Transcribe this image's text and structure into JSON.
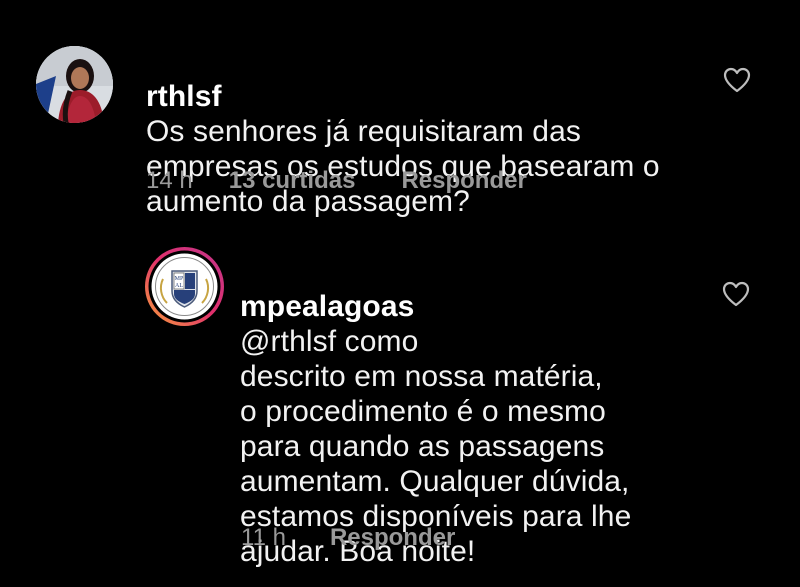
{
  "comments": [
    {
      "username": "rthlsf",
      "text": "Os senhores já requisitaram das\nempresas os estudos que basearam  o\naumento da passagem?",
      "time": "14 h",
      "likes": "13 curtidas",
      "reply": "Responder",
      "avatar": "profile-photo"
    },
    {
      "username": "mpealagoas",
      "mention": "@rthlsf",
      "text": "  como\ndescrito em nossa matéria,\no procedimento é o mesmo\npara quando as passagens\naumentam. Qualquer dúvida,\nestamos disponíveis para lhe\najudar. Boa noite!",
      "time": "11 h",
      "reply": "Responder",
      "avatar_logo_text": "MP\nAL",
      "avatar": "institution-logo"
    }
  ],
  "colors": {
    "background": "#000000",
    "text": "#f2f2f2",
    "meta": "#9a9a9a",
    "story_ring_start": "#f9a23b",
    "story_ring_end": "#c1358c"
  },
  "icons": {
    "like": "heart-outline-icon"
  }
}
